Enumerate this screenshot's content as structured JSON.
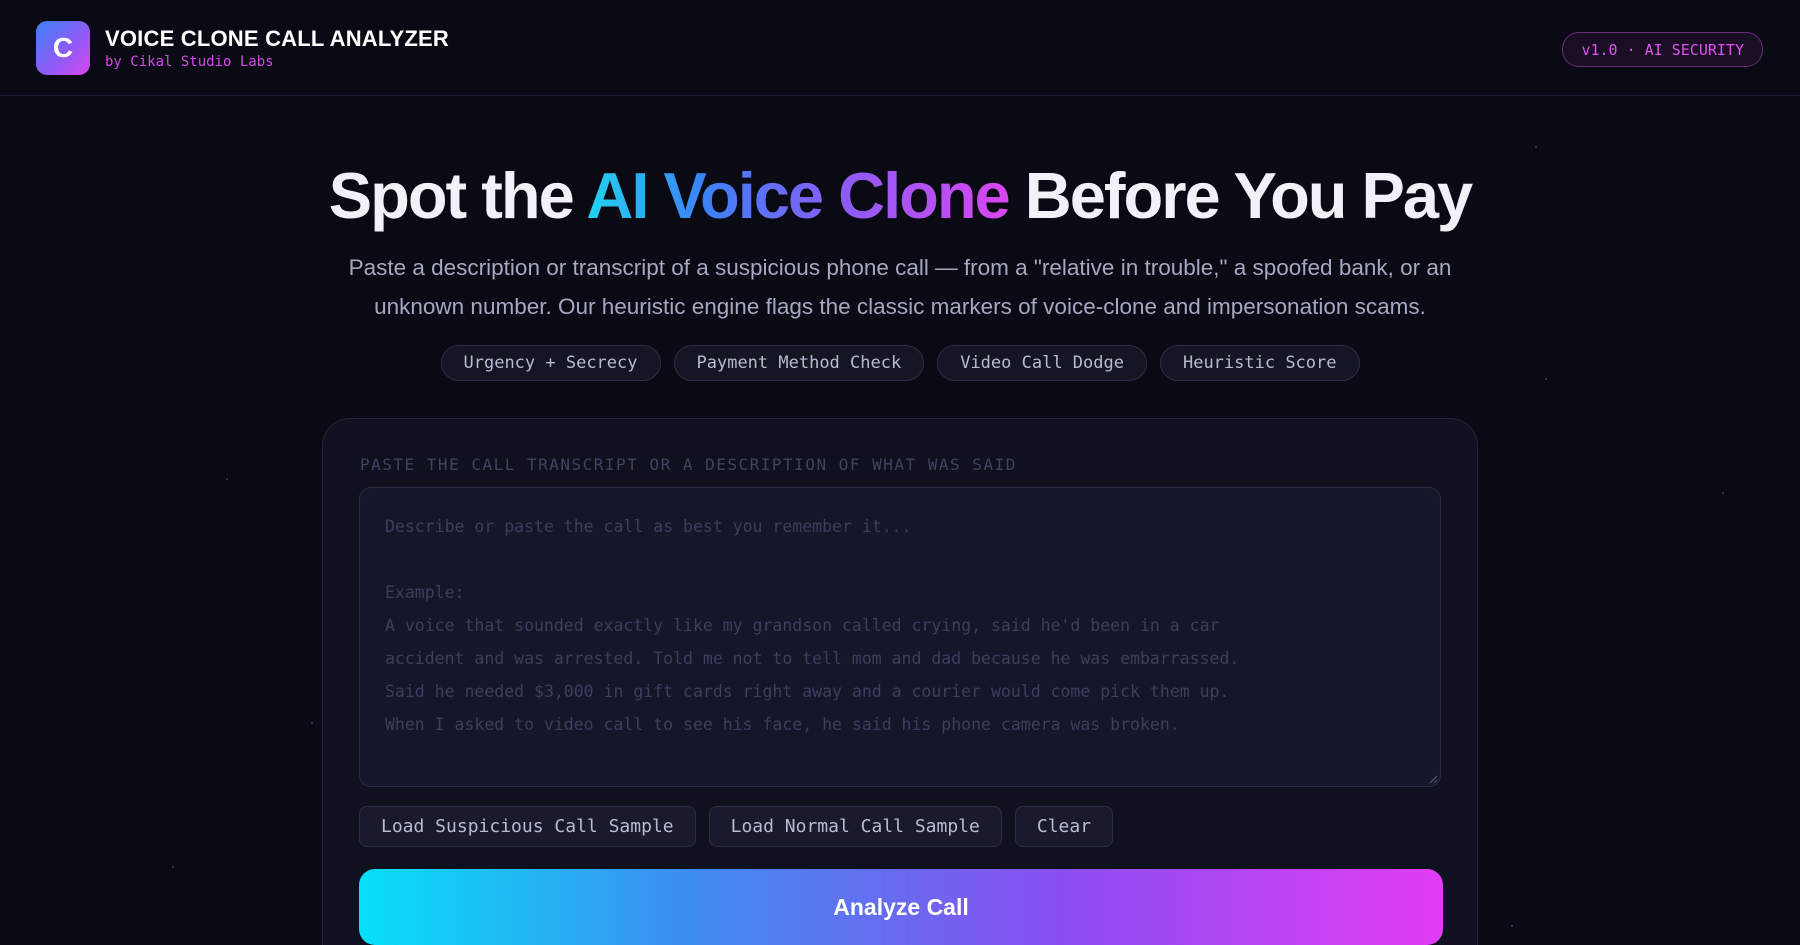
{
  "header": {
    "logo_letter": "C",
    "title": "VOICE CLONE CALL ANALYZER",
    "subtitle": "by Cikal Studio Labs",
    "version_badge": "v1.0 · AI SECURITY"
  },
  "hero": {
    "title_prefix": "Spot the ",
    "title_highlight": "AI Voice Clone",
    "title_suffix": " Before You Pay",
    "description": "Paste a description or transcript of a suspicious phone call — from a \"relative in trouble,\" a spoofed bank, or an unknown number. Our heuristic engine flags the classic markers of voice-clone and impersonation scams.",
    "chips": [
      "Urgency + Secrecy",
      "Payment Method Check",
      "Video Call Dodge",
      "Heuristic Score"
    ]
  },
  "analyzer": {
    "field_label": "PASTE THE CALL TRANSCRIPT OR A DESCRIPTION OF WHAT WAS SAID",
    "transcript_value": "",
    "transcript_placeholder": "Describe or paste the call as best you remember it...\n\nExample:\nA voice that sounded exactly like my grandson called crying, said he'd been in a car\naccident and was arrested. Told me not to tell mom and dad because he was embarrassed.\nSaid he needed $3,000 in gift cards right away and a courier would come pick them up.\nWhen I asked to video call to see his face, he said his phone camera was broken.",
    "buttons": {
      "load_suspicious": "Load Suspicious Call Sample",
      "load_normal": "Load Normal Call Sample",
      "clear": "Clear"
    },
    "analyze_label": "Analyze Call"
  },
  "colors": {
    "background": "#0a0a14",
    "accent_cyan": "#22d3ee",
    "accent_blue": "#3b82f6",
    "accent_purple": "#8b5cf6",
    "accent_magenta": "#d946ef"
  },
  "icons": {
    "resize_handle": "resize-grip-icon"
  }
}
